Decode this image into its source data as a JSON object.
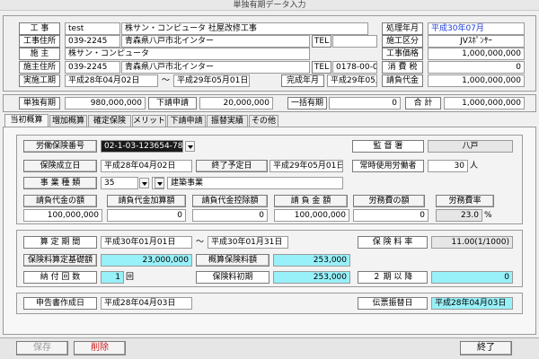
{
  "window": {
    "title": "単独有期データ入力"
  },
  "header": {
    "construction_label": "工 事",
    "construction_code": "test",
    "construction_name": "株サン・コンピュータ 社屋改修工事",
    "processing_month_label": "処理年月",
    "processing_month": "平成30年07月",
    "site_address_label": "工事住所",
    "site_zip": "039-2245",
    "site_address": "青森県八戸市北インター",
    "tel_label": "TEL",
    "site_tel": "",
    "division_label": "施工区分",
    "division": "JVｽﾎﾟﾝｻｰ",
    "client_label": "施 主",
    "client_name": "株サン・コンピュータ",
    "contract_price_label": "工事価格",
    "contract_price": "1,000,000,000",
    "client_address_label": "施主住所",
    "client_zip": "039-2245",
    "client_address": "青森県八戸市北インター",
    "client_tel": "0178-00-0000",
    "tax_label": "消 費 税",
    "tax": "0",
    "period_label": "実施工期",
    "period_start": "平成28年04月02日",
    "tilde": "〜",
    "period_end": "平成29年05月01日",
    "completion_label": "完成年月",
    "completion": "平成29年05月",
    "contract_amount_label": "請負代金",
    "contract_amount": "1,000,000,000"
  },
  "summary": {
    "single_label": "単独有期",
    "single_value": "980,000,000",
    "sub_label": "下請申請",
    "sub_value": "20,000,000",
    "lump_label": "一括有期",
    "lump_value": "0",
    "total_label": "合 計",
    "total_value": "1,000,000,000"
  },
  "tabs": [
    "当初概算",
    "増加概算",
    "確定保険",
    "メリット",
    "下請申請",
    "振替実績",
    "その他"
  ],
  "form": {
    "insurance_no_label": "労働保険番号",
    "insurance_no": "02-1-03-123654-789",
    "supervisor_label": "監 督 署",
    "supervisor": "八戸",
    "established_label": "保険成立日",
    "established": "平成28年04月02日",
    "end_label": "終了予定日",
    "end_date": "平成29年05月01日",
    "workers_label": "常時使用労働者",
    "workers": "30",
    "workers_unit": "人",
    "business_type_label": "事 業 種 類",
    "business_code1": "35",
    "business_code2": "",
    "business_name": "建築事業",
    "col1_label": "請負代金の額",
    "col1_value": "100,000,000",
    "col2_label": "請負代金加算額",
    "col2_value": "0",
    "col3_label": "請負代金控除額",
    "col3_value": "0",
    "col4_label": "請 負 金 額",
    "col4_value": "100,000,000",
    "col5_label": "労務費の額",
    "col5_value": "0",
    "col6_label": "労務費率",
    "col6_value": "23.0",
    "col6_unit": "%"
  },
  "calc": {
    "period_label": "算 定 期 間",
    "period_start": "平成30年01月01日",
    "tilde": "〜",
    "period_end": "平成30年01月31日",
    "rate_label": "保 険 料 率",
    "rate": "11.00(1/1000)",
    "base_label": "保険料算定基礎額",
    "base": "23,000,000",
    "estimate_label": "概算保険料額",
    "estimate": "253,000",
    "installments_label": "納 付 回 数",
    "installments": "1",
    "installments_unit": "回",
    "first_label": "保険料初期",
    "first": "253,000",
    "second_label": "２ 期 以 降",
    "second": "0"
  },
  "dates": {
    "report_label": "申告書作成日",
    "report_date": "平成28年04月03日",
    "slip_label": "伝票振替日",
    "slip_date": "平成28年04月03日"
  },
  "footer": {
    "save": "保存",
    "delete": "削除",
    "close": "終了"
  }
}
